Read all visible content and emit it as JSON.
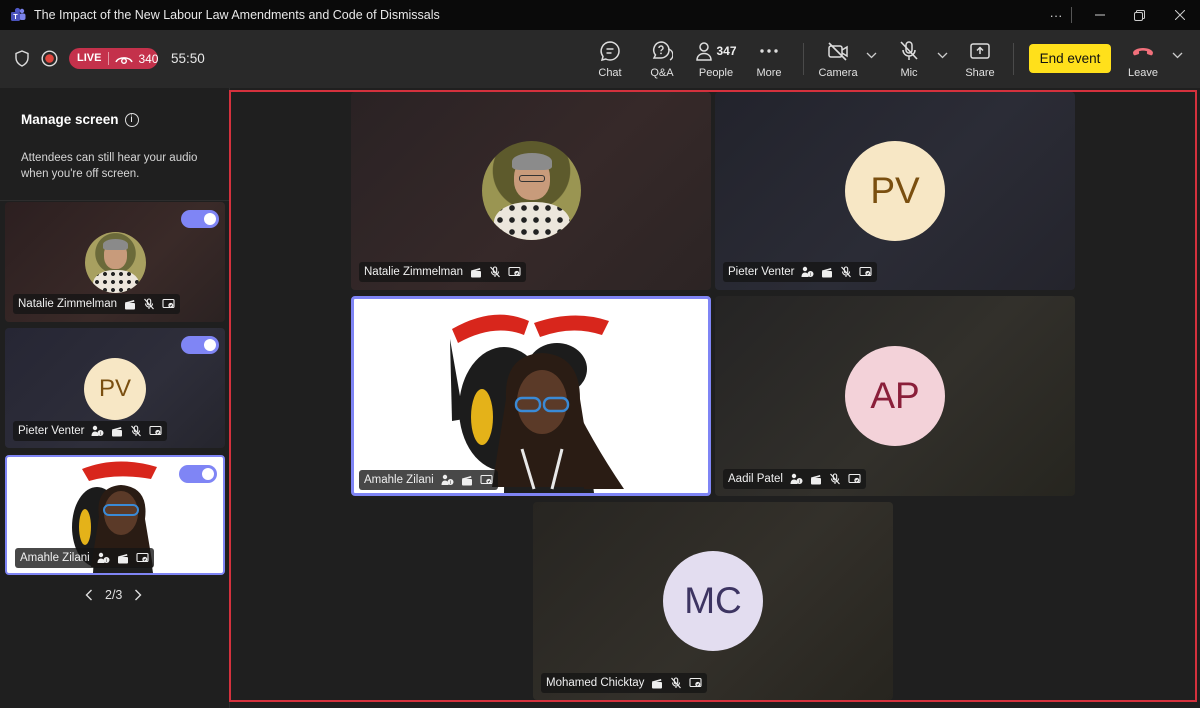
{
  "window": {
    "title": "The Impact of the New Labour Law Amendments and Code of Dismissals"
  },
  "toolbar": {
    "live_label": "LIVE",
    "viewer_count": "340",
    "timer": "55:50",
    "chat_label": "Chat",
    "qa_label": "Q&A",
    "people_count": "347",
    "people_label": "People",
    "more_label": "More",
    "camera_label": "Camera",
    "mic_label": "Mic",
    "share_label": "Share",
    "end_label": "End event",
    "leave_label": "Leave"
  },
  "sidebar": {
    "title": "Manage screen",
    "description": "Attendees can still hear your audio when you're off screen.",
    "thumbnails": [
      {
        "name": "Natalie Zimmelman",
        "type": "photo"
      },
      {
        "name": "Pieter Venter",
        "initials": "PV",
        "type": "initials"
      },
      {
        "name": "Amahle Zilani",
        "type": "video"
      }
    ],
    "pager": "2/3"
  },
  "stage": {
    "tiles": [
      {
        "name": "Natalie Zimmelman",
        "type": "photo"
      },
      {
        "name": "Pieter Venter",
        "initials": "PV",
        "type": "initials"
      },
      {
        "name": "Amahle Zilani",
        "type": "video"
      },
      {
        "name": "Aadil Patel",
        "initials": "AP",
        "type": "initials"
      },
      {
        "name": "Mohamed Chicktay",
        "initials": "MC",
        "type": "initials"
      }
    ]
  },
  "colors": {
    "accent": "#7f85f5",
    "live": "#c4314b",
    "end_event": "#ffe01b",
    "stage_border": "#d4313d",
    "pv_bg": "#f7e7c5",
    "pv_fg": "#7a4f10",
    "ap_bg": "#f3d2d9",
    "ap_fg": "#8a1f3a",
    "mc_bg": "#e3ddf0",
    "mc_fg": "#3d3462"
  },
  "icons": [
    "teams-logo",
    "shield-icon",
    "record-icon",
    "eye-icon",
    "chat-icon",
    "qa-icon",
    "people-icon",
    "more-icon",
    "camera-off-icon",
    "mic-off-icon",
    "share-icon",
    "phone-leave-icon",
    "chevron-down-icon",
    "info-icon",
    "clapper-icon",
    "mic-muted-icon",
    "screen-icon",
    "hand-icon",
    "chevron-left-icon",
    "chevron-right-icon"
  ]
}
